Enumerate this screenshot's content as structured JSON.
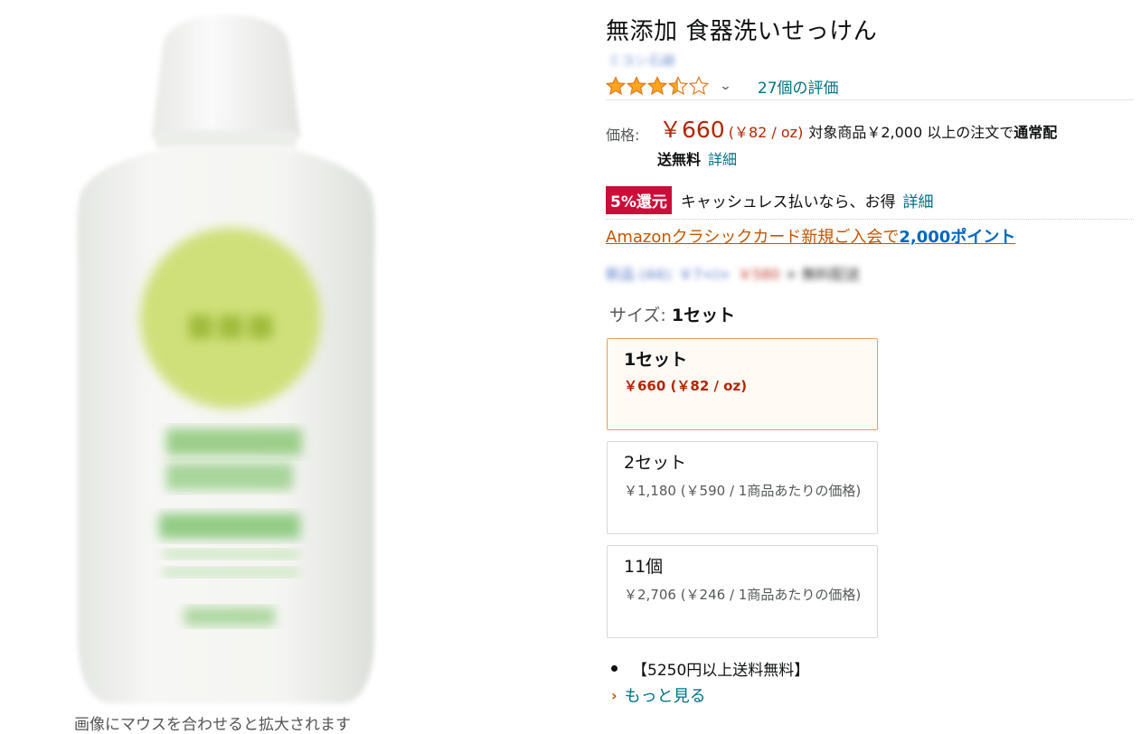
{
  "product": {
    "title": "無添加 食器洗いせっけん",
    "brand": "ミヨシ石鹸",
    "rating": {
      "stars": 3.5,
      "max": 5,
      "count_text": "27個の評価"
    },
    "image_hint": "画像にマウスを合わせると拡大されます"
  },
  "price": {
    "label": "価格:",
    "main": "￥660",
    "unit": "(￥82 / oz)",
    "shipping_prefix": "対象商品￥2,000 以上の注文で",
    "shipping_bold": "通常配",
    "line2_bold": "送無料",
    "detail_link": "詳細"
  },
  "cashback": {
    "badge": "5%還元",
    "text": "キャッシュレス払いなら、お得",
    "detail_link": "詳細"
  },
  "card_promo": {
    "text": "Amazonクラシックカード新規ご入会で",
    "points": "2,000ポイント"
  },
  "other_offers": {
    "text": "新品 (44): ￥7<i>",
    "price": "￥580",
    "shipping": "+ 無料配送"
  },
  "size": {
    "label": "サイズ:",
    "selected": "1セット",
    "options": [
      {
        "name": "1セット",
        "price": "￥660 (￥82 / oz)",
        "selected": true
      },
      {
        "name": "2セット",
        "price": "￥1,180 (￥590 / 1商品あたりの価格)",
        "selected": false
      },
      {
        "name": "11個",
        "price": "￥2,706 (￥246 / 1商品あたりの価格)",
        "selected": false
      }
    ]
  },
  "bullets": [
    "【5250円以上送料無料】"
  ],
  "more_link": "もっと見る",
  "colors": {
    "price_red": "#b12704",
    "link": "#007185",
    "badge_red": "#cc0c39",
    "star": "#ffa41c"
  }
}
